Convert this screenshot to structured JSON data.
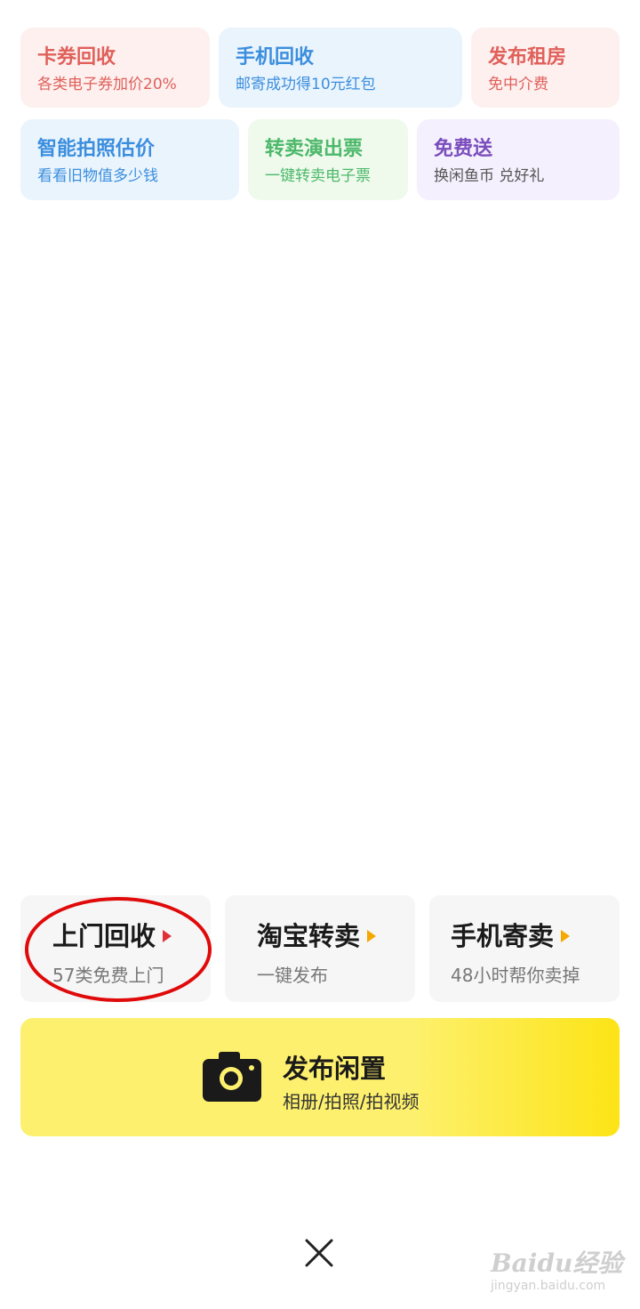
{
  "cards": [
    {
      "title": "卡券回收",
      "subtitle": "各类电子券加价20%"
    },
    {
      "title": "手机回收",
      "subtitle": "邮寄成功得10元红包"
    },
    {
      "title": "发布租房",
      "subtitle": "免中介费"
    },
    {
      "title": "智能拍照估价",
      "subtitle": "看看旧物值多少钱"
    },
    {
      "title": "转卖演出票",
      "subtitle": "一键转卖电子票"
    },
    {
      "title": "免费送",
      "subtitle": "换闲鱼币 兑好礼"
    }
  ],
  "tiles": [
    {
      "title": "上门回收",
      "subtitle": "57类免费上门"
    },
    {
      "title": "淘宝转卖",
      "subtitle": "一键发布"
    },
    {
      "title": "手机寄卖",
      "subtitle": "48小时帮你卖掉"
    }
  ],
  "publish": {
    "title": "发布闲置",
    "subtitle": "相册/拍照/拍视频",
    "icon": "camera-icon"
  },
  "close_icon": "close-icon",
  "watermark": {
    "brand": "Baidu经验",
    "url": "jingyan.baidu.com"
  },
  "colors": {
    "accent_yellow": "#fde416",
    "highlight_circle": "#e00a0a"
  }
}
